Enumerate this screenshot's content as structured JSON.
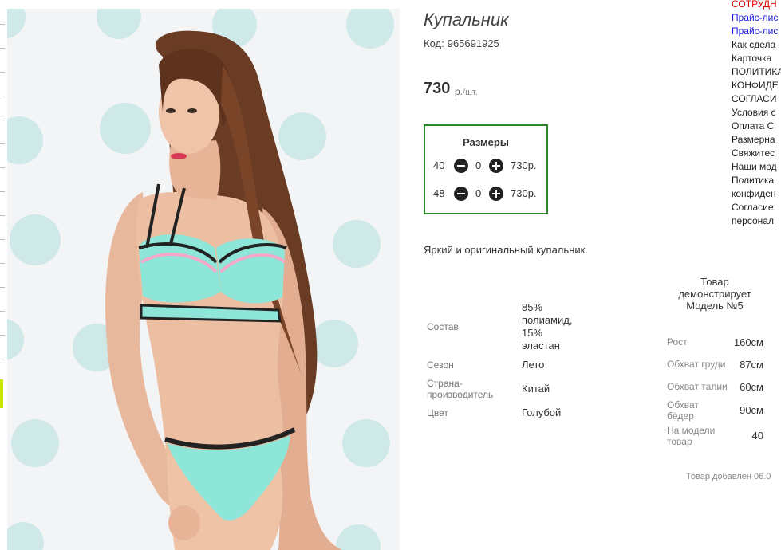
{
  "product": {
    "title": "Купальник",
    "code_label": "Код:",
    "code": "965691925",
    "price": "730",
    "price_unit": "р.",
    "price_per": "/шт.",
    "description": "Яркий и оригинальный купальник.",
    "added": "Товар добавлен 06.0"
  },
  "sizes": {
    "title": "Размеры",
    "rows": [
      {
        "size": "40",
        "qty": "0",
        "price": "730р."
      },
      {
        "size": "48",
        "qty": "0",
        "price": "730р."
      }
    ]
  },
  "specs": {
    "composition_label": "Состав",
    "composition_value": [
      "85%",
      "полиамид,",
      "15%",
      "эластан"
    ],
    "season_label": "Сезон",
    "season_value": "Лето",
    "country_label": [
      "Страна-",
      "производитель"
    ],
    "country_value": "Китай",
    "color_label": "Цвет",
    "color_value": "Голубой"
  },
  "model": {
    "heading": [
      "Товар",
      "демонстрирует",
      "Модель №5"
    ],
    "height_label": "Рост",
    "height_value": "160см",
    "chest_label": "Обхват груди",
    "chest_value": "87см",
    "waist_label": "Обхват талии",
    "waist_value": "60см",
    "hips_label": [
      "Обхват",
      "бёдер"
    ],
    "hips_value": "90см",
    "size_label": [
      "На модели",
      "товар"
    ],
    "size_value": "40"
  },
  "right_menu": {
    "items": [
      {
        "label": "СОТРУДН",
        "color": "red"
      },
      {
        "label": "Прайс-лис",
        "color": "blue"
      },
      {
        "label": "Прайс-лис",
        "color": "blue"
      },
      {
        "label": "Как сдела",
        "color": "default"
      },
      {
        "label": "Карточка",
        "color": "default"
      },
      {
        "label": "ПОЛИТИКА",
        "color": "default"
      },
      {
        "label": "КОНФИДЕ",
        "color": "default"
      },
      {
        "label": "СОГЛАСИ",
        "color": "default"
      },
      {
        "label": "Условия с",
        "color": "default"
      },
      {
        "label": "Оплата С",
        "color": "default"
      },
      {
        "label": "Размерна",
        "color": "default"
      },
      {
        "label": "Свяжитес",
        "color": "default"
      },
      {
        "label": "Наши мод",
        "color": "default"
      },
      {
        "label": "Политика",
        "color": "default"
      },
      {
        "label": "конфиден",
        "color": "default"
      },
      {
        "label": "Согласие",
        "color": "default"
      },
      {
        "label": "персонал",
        "color": "default"
      }
    ]
  },
  "colors": {
    "sizes_border": "#2a8a2a",
    "menu_red": "#e00000",
    "menu_blue": "#1a1ae6",
    "swimsuit": "#8ee6d9"
  }
}
